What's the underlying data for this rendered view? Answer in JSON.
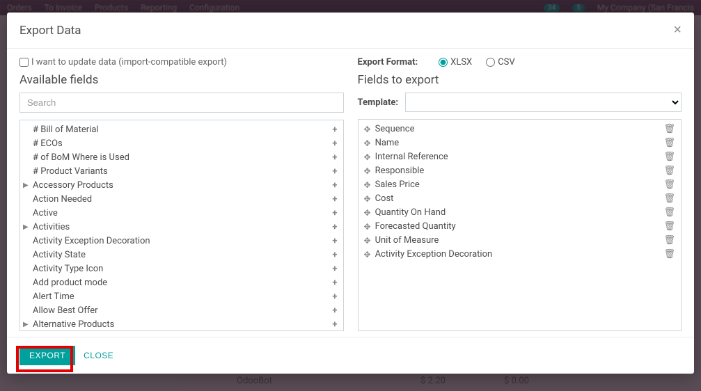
{
  "nav": {
    "items": [
      "Orders",
      "To Invoice",
      "Products",
      "Reporting",
      "Configuration"
    ],
    "badge1": "34",
    "badge2": "5",
    "company": "My Company (San Francis"
  },
  "bg_rows": [
    {
      "name": "OdooBot",
      "price": "$ 2.20",
      "cost": "$ 0.00"
    }
  ],
  "modal": {
    "title": "Export Data",
    "checkbox_label": "I want to update data (import-compatible export)",
    "available_heading": "Available fields",
    "search_placeholder": "Search",
    "format_label": "Export Format:",
    "format_xlsx": "XLSX",
    "format_csv": "CSV",
    "fields_heading": "Fields to export",
    "template_label": "Template:",
    "export_btn": "EXPORT",
    "close_btn": "CLOSE"
  },
  "available_fields": [
    {
      "label": "# Bill of Material",
      "expandable": false
    },
    {
      "label": "# ECOs",
      "expandable": false
    },
    {
      "label": "# of BoM Where is Used",
      "expandable": false
    },
    {
      "label": "# Product Variants",
      "expandable": false
    },
    {
      "label": "Accessory Products",
      "expandable": true
    },
    {
      "label": "Action Needed",
      "expandable": false
    },
    {
      "label": "Active",
      "expandable": false
    },
    {
      "label": "Activities",
      "expandable": true
    },
    {
      "label": "Activity Exception Decoration",
      "expandable": false
    },
    {
      "label": "Activity State",
      "expandable": false
    },
    {
      "label": "Activity Type Icon",
      "expandable": false
    },
    {
      "label": "Add product mode",
      "expandable": false
    },
    {
      "label": "Alert Time",
      "expandable": false
    },
    {
      "label": "Allow Best Offer",
      "expandable": false
    },
    {
      "label": "Alternative Products",
      "expandable": true
    }
  ],
  "export_fields": [
    {
      "label": "Sequence"
    },
    {
      "label": "Name"
    },
    {
      "label": "Internal Reference"
    },
    {
      "label": "Responsible"
    },
    {
      "label": "Sales Price"
    },
    {
      "label": "Cost"
    },
    {
      "label": "Quantity On Hand"
    },
    {
      "label": "Forecasted Quantity"
    },
    {
      "label": "Unit of Measure"
    },
    {
      "label": "Activity Exception Decoration"
    }
  ]
}
